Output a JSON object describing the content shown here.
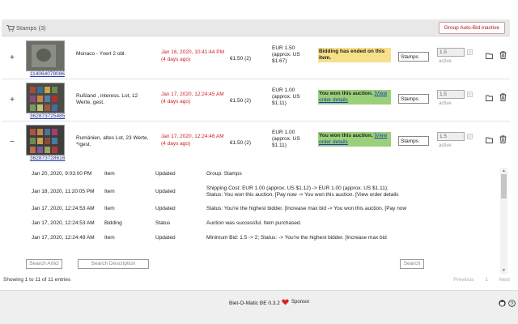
{
  "group": {
    "title": "Stamps (3)",
    "autobid_button": "Group Auto-Bid inactive"
  },
  "items": [
    {
      "toggle": "+",
      "item_id": "114064078086",
      "title": "Monaco - Yvert 2 obl.",
      "end_time": "Jan 16, 2020, 10:41:44 PM",
      "end_ago": "(4 days ago)",
      "bid": "€1.50 (2)",
      "price": "EUR 1.50 (approx. US $1.67)",
      "status_text": "Bidding has ended on this item.",
      "status_link": "",
      "status_type": "ended",
      "group_value": "Stamps",
      "max_bid": "1.5",
      "active_label": "active"
    },
    {
      "toggle": "+",
      "item_id": "362873725485",
      "title": "Rußland , interess. Lot, 12 Werte, gest.",
      "end_time": "Jan 17, 2020, 12:24:45 AM",
      "end_ago": "(4 days ago)",
      "bid": "€1.50 (2)",
      "price": "EUR 1.00 (approx. US $1.11)",
      "status_text": "You won this auction. ",
      "status_link": "[View order details",
      "status_type": "won",
      "group_value": "Stamps",
      "max_bid": "1.5",
      "active_label": "active"
    },
    {
      "toggle": "−",
      "item_id": "362873728616",
      "title": "Rumänien, altes Lot, 23 Werte, */gest.",
      "end_time": "Jan 17, 2020, 12:24:46 AM",
      "end_ago": "(4 days ago)",
      "bid": "€1.50 (2)",
      "price": "EUR 1.00 (approx. US $1.11)",
      "status_text": "You won this auction. ",
      "status_link": "[View order details",
      "status_type": "won",
      "group_value": "Stamps",
      "max_bid": "1.5",
      "active_label": "active"
    }
  ],
  "events": [
    {
      "date": "Jan 20, 2020, 9:03:00 PM",
      "type": "Item",
      "state": "Updated",
      "desc": "Group: Stamps"
    },
    {
      "date": "Jan 18, 2020, 11:20:05 PM",
      "type": "Item",
      "state": "Updated",
      "desc": "Shipping Cost: EUR 1.00 (approx. US $1.12) -> EUR 1.00 (approx. US $1.11); Status: You won this auction. [Pay now -> You won this auction. [View order details"
    },
    {
      "date": "Jan 17, 2020, 12:24:53 AM",
      "type": "Item",
      "state": "Updated",
      "desc": "Status: You're the highest bidder. [Increase max bid -> You won this auction. [Pay now"
    },
    {
      "date": "Jan 17, 2020, 12:24:53 AM",
      "type": "Bidding",
      "state": "Status",
      "desc": "Auction was successful. Item purchased."
    },
    {
      "date": "Jan 17, 2020, 12:24:49 AM",
      "type": "Item",
      "state": "Updated",
      "desc": "Minimum Bid: 1.5 -> 2; Status: -> You're the highest bidder. [Increase max bid"
    }
  ],
  "filters": {
    "article": "Search Articl",
    "description": "Search Description",
    "search": "Search"
  },
  "footer": {
    "entries": "Showing 1 to 11 of 11 entries",
    "previous": "Previous",
    "page": "1",
    "next": "Next"
  },
  "bottom": {
    "version": "Biet-O-Matic BE 0.3.2",
    "sponsor": "Sponsor"
  },
  "colors": {
    "ended_bg": "#f7e08a",
    "won_bg": "#9ad07a",
    "end_time": "#cc2222",
    "link": "#1c39b3"
  }
}
